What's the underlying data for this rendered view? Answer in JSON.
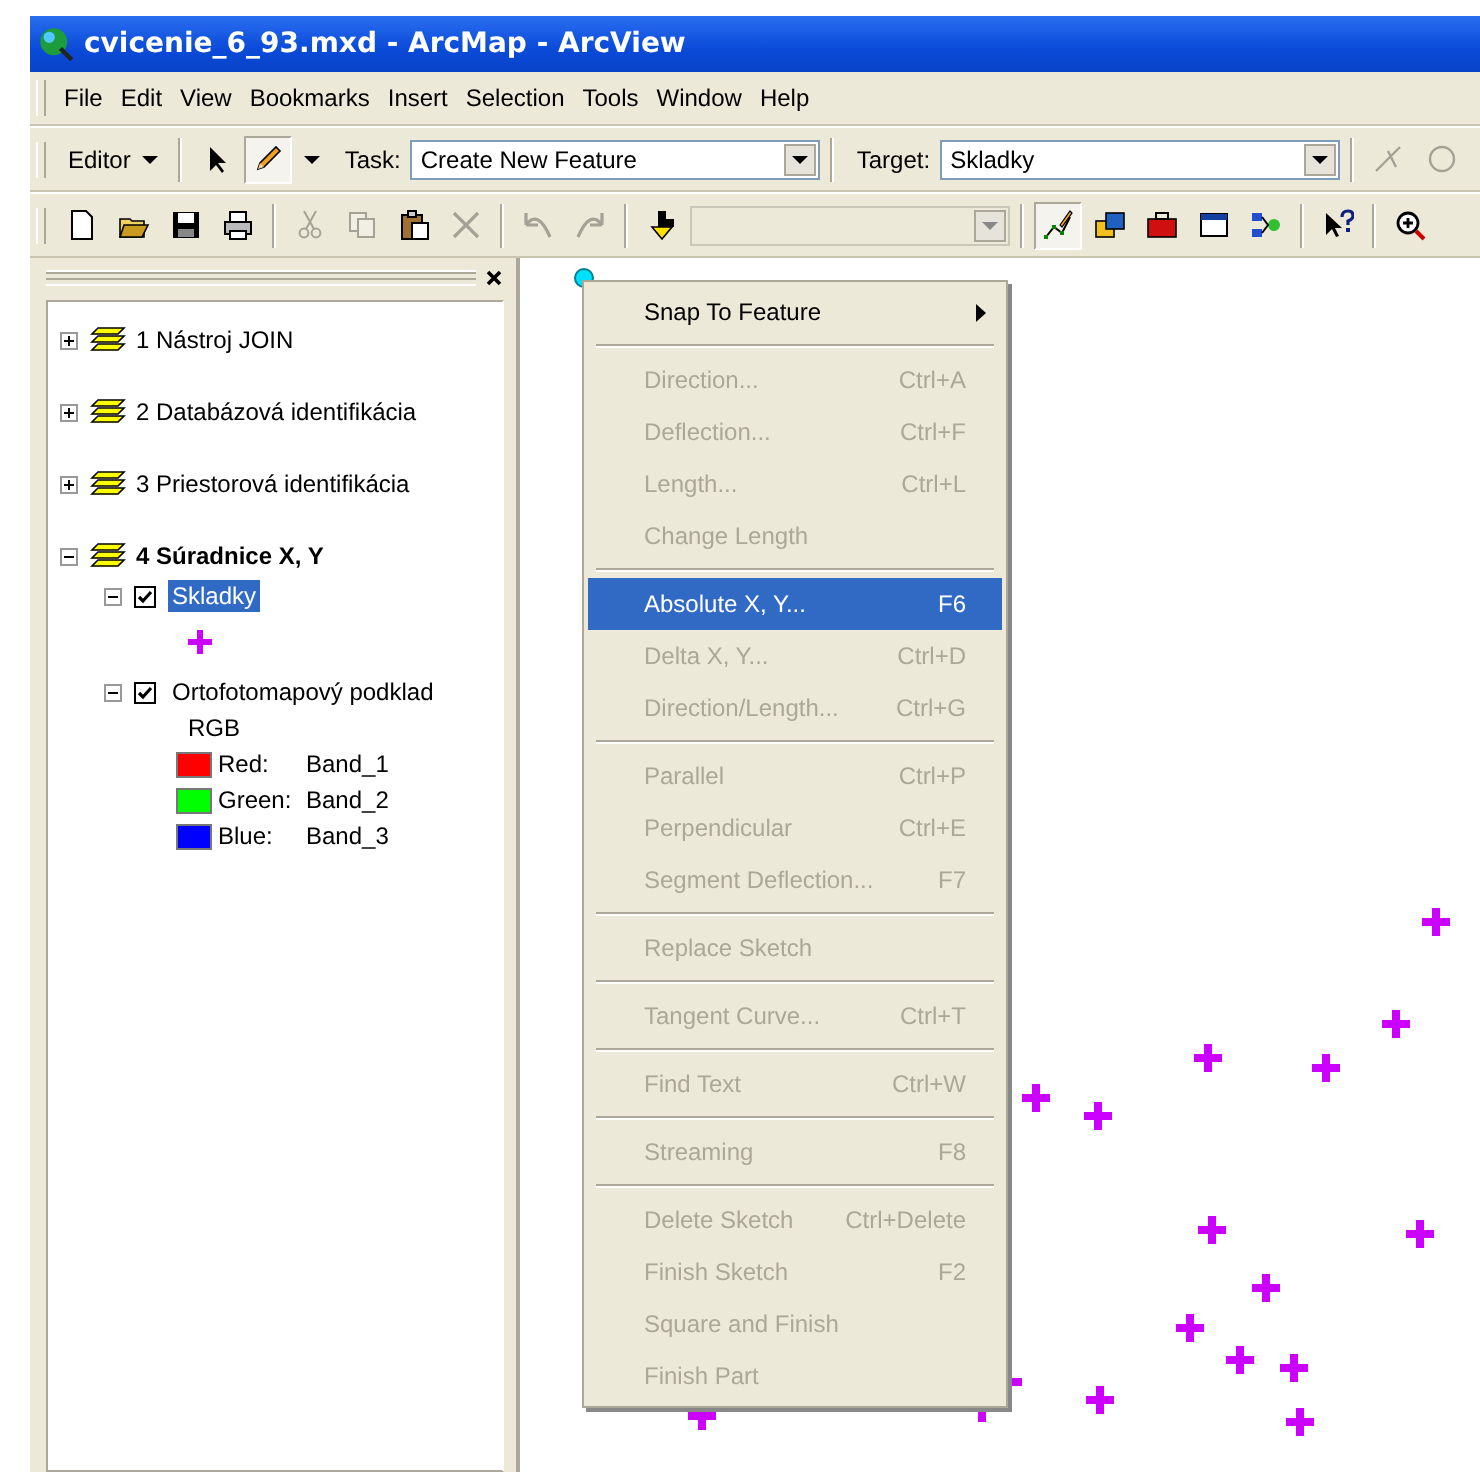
{
  "window": {
    "title": "cvicenie_6_93.mxd - ArcMap - ArcView"
  },
  "menu_bar": [
    "File",
    "Edit",
    "View",
    "Bookmarks",
    "Insert",
    "Selection",
    "Tools",
    "Window",
    "Help"
  ],
  "editor_toolbar": {
    "editor_menu": "Editor",
    "tools": [
      {
        "kind": "pointer",
        "selected": false,
        "disabled": false
      },
      {
        "kind": "pencil",
        "selected": true,
        "disabled": false
      }
    ],
    "task_label": "Task:",
    "task_value": "Create New Feature",
    "target_label": "Target:",
    "target_value": "Skladky",
    "trailing_tools": [
      {
        "kind": "split",
        "disabled": true
      },
      {
        "kind": "rotate",
        "disabled": true
      }
    ]
  },
  "standard_toolbar": [
    {
      "kind": "new",
      "disabled": false,
      "selected": false
    },
    {
      "kind": "open",
      "disabled": false,
      "selected": false
    },
    {
      "kind": "save",
      "disabled": false,
      "selected": false
    },
    {
      "kind": "print",
      "disabled": false,
      "selected": false
    },
    {
      "kind": "separator"
    },
    {
      "kind": "cut",
      "disabled": true,
      "selected": false
    },
    {
      "kind": "copy",
      "disabled": true,
      "selected": false
    },
    {
      "kind": "paste",
      "disabled": false,
      "selected": false
    },
    {
      "kind": "delete",
      "disabled": true,
      "selected": false
    },
    {
      "kind": "separator"
    },
    {
      "kind": "undo",
      "disabled": true,
      "selected": false
    },
    {
      "kind": "redo",
      "disabled": true,
      "selected": false
    },
    {
      "kind": "separator"
    },
    {
      "kind": "add-data",
      "disabled": false,
      "selected": false
    },
    {
      "kind": "combo",
      "disabled": true
    },
    {
      "kind": "separator"
    },
    {
      "kind": "sketch",
      "disabled": false,
      "selected": true
    },
    {
      "kind": "catalog",
      "disabled": false,
      "selected": false
    },
    {
      "kind": "toolbox",
      "disabled": false,
      "selected": false
    },
    {
      "kind": "command",
      "disabled": false,
      "selected": false
    },
    {
      "kind": "model",
      "disabled": false,
      "selected": false
    },
    {
      "kind": "separator"
    },
    {
      "kind": "whats-this",
      "disabled": false,
      "selected": false
    },
    {
      "kind": "separator"
    },
    {
      "kind": "zoom",
      "disabled": false,
      "selected": false
    }
  ],
  "table_of_contents": {
    "layers": [
      {
        "name": "1 Nástroj JOIN",
        "expanded": false,
        "active": false
      },
      {
        "name": "2 Databázová identifikácia",
        "expanded": false,
        "active": false
      },
      {
        "name": "3 Priestorová identifikácia",
        "expanded": false,
        "active": false
      },
      {
        "name": "4 Súradnice X, Y",
        "expanded": true,
        "active": true,
        "children": [
          {
            "name": "Skladky",
            "expanded": true,
            "checked": true,
            "selected": true,
            "legend": [
              {
                "kind": "point-symbol",
                "color": "#cc00ff"
              }
            ]
          },
          {
            "name": "Ortofotomapový podklad",
            "expanded": true,
            "checked": true,
            "selected": false,
            "legend": [
              {
                "kind": "heading",
                "text": "RGB"
              },
              {
                "kind": "swatch",
                "color": "#ff0000",
                "label": "Red:",
                "value": "Band_1"
              },
              {
                "kind": "swatch",
                "color": "#00ff00",
                "label": "Green:",
                "value": "Band_2"
              },
              {
                "kind": "swatch",
                "color": "#0000ff",
                "label": "Blue:",
                "value": "Band_3"
              }
            ]
          }
        ]
      }
    ]
  },
  "context_menu": [
    {
      "kind": "item",
      "label": "Snap To Feature",
      "submenu": true,
      "disabled": false,
      "selected": false
    },
    {
      "kind": "separator"
    },
    {
      "kind": "item",
      "label": "Direction...",
      "shortcut": "Ctrl+A",
      "disabled": true,
      "selected": false
    },
    {
      "kind": "item",
      "label": "Deflection...",
      "shortcut": "Ctrl+F",
      "disabled": true,
      "selected": false
    },
    {
      "kind": "item",
      "label": "Length...",
      "shortcut": "Ctrl+L",
      "disabled": true,
      "selected": false
    },
    {
      "kind": "item",
      "label": "Change Length",
      "disabled": true,
      "selected": false
    },
    {
      "kind": "separator"
    },
    {
      "kind": "item",
      "label": "Absolute X, Y...",
      "shortcut": "F6",
      "disabled": false,
      "selected": true
    },
    {
      "kind": "item",
      "label": "Delta X, Y...",
      "shortcut": "Ctrl+D",
      "disabled": true,
      "selected": false
    },
    {
      "kind": "item",
      "label": "Direction/Length...",
      "shortcut": "Ctrl+G",
      "disabled": true,
      "selected": false
    },
    {
      "kind": "separator"
    },
    {
      "kind": "item",
      "label": "Parallel",
      "shortcut": "Ctrl+P",
      "disabled": true,
      "selected": false
    },
    {
      "kind": "item",
      "label": "Perpendicular",
      "shortcut": "Ctrl+E",
      "disabled": true,
      "selected": false
    },
    {
      "kind": "item",
      "label": "Segment Deflection...",
      "shortcut": "F7",
      "disabled": true,
      "selected": false
    },
    {
      "kind": "separator"
    },
    {
      "kind": "item",
      "label": "Replace Sketch",
      "disabled": true,
      "selected": false
    },
    {
      "kind": "separator"
    },
    {
      "kind": "item",
      "label": "Tangent Curve...",
      "shortcut": "Ctrl+T",
      "disabled": true,
      "selected": false
    },
    {
      "kind": "separator"
    },
    {
      "kind": "item",
      "label": "Find Text",
      "shortcut": "Ctrl+W",
      "disabled": true,
      "selected": false
    },
    {
      "kind": "separator"
    },
    {
      "kind": "item",
      "label": "Streaming",
      "shortcut": "F8",
      "disabled": true,
      "selected": false
    },
    {
      "kind": "separator"
    },
    {
      "kind": "item",
      "label": "Delete Sketch",
      "shortcut": "Ctrl+Delete",
      "disabled": true,
      "selected": false
    },
    {
      "kind": "item",
      "label": "Finish Sketch",
      "shortcut": "F2",
      "disabled": true,
      "selected": false
    },
    {
      "kind": "item",
      "label": "Square and Finish",
      "disabled": true,
      "selected": false
    },
    {
      "kind": "item",
      "label": "Finish Part",
      "disabled": true,
      "selected": false
    }
  ]
}
